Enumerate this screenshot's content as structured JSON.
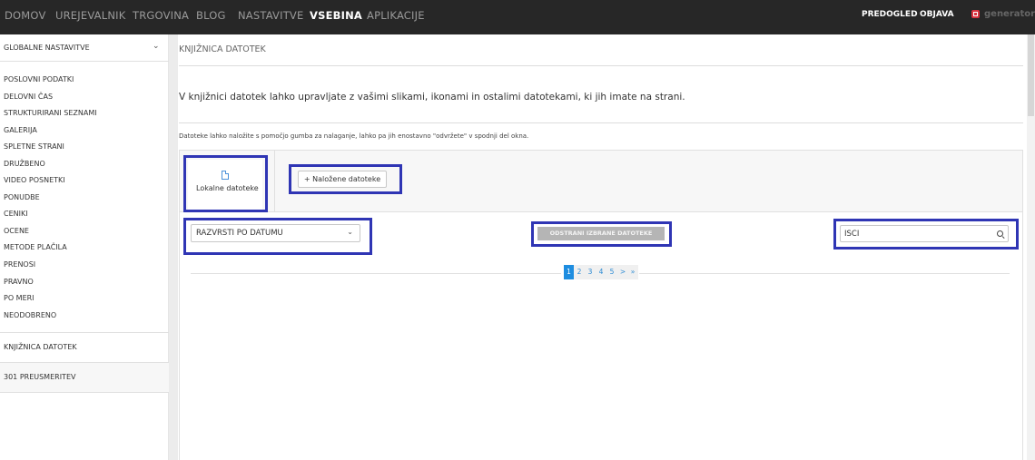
{
  "topnav": {
    "items": [
      {
        "label": "DOMOV"
      },
      {
        "label": "UREJEVALNIK"
      },
      {
        "label": "TRGOVINA"
      },
      {
        "label": "BLOG"
      },
      {
        "label": "NASTAVITVE"
      },
      {
        "label": "VSEBINA",
        "active": true
      },
      {
        "label": "APLIKACIJE"
      }
    ],
    "preview_label": "PREDOGLED",
    "publish_label": "OBJAVA",
    "brand_label": "generator"
  },
  "sidebar": {
    "header": "GLOBALNE NASTAVITVE",
    "items": [
      {
        "label": "POSLOVNI PODATKI"
      },
      {
        "label": "DELOVNI ČAS"
      },
      {
        "label": "STRUKTURIRANI SEZNAMI"
      },
      {
        "label": "GALERIJA"
      },
      {
        "label": "SPLETNE STRANI"
      },
      {
        "label": "DRUŽBENO"
      },
      {
        "label": "VIDEO POSNETKI"
      },
      {
        "label": "PONUDBE"
      },
      {
        "label": "CENIKI"
      },
      {
        "label": "OCENE"
      },
      {
        "label": "METODE PLAČILA"
      },
      {
        "label": "PRENOSI"
      },
      {
        "label": "PRAVNO"
      },
      {
        "label": "PO MERI"
      },
      {
        "label": "NEODOBRENO"
      }
    ],
    "file_library": "KNJIŽNICA DATOTEK",
    "redirects": "301 PREUSMERITEV"
  },
  "main": {
    "title": "KNJIŽNICA DATOTEK",
    "lead": "V knjižnici datotek lahko upravljate z vašimi slikami, ikonami in ostalimi datotekami, ki jih imate na strani.",
    "note": "Datoteke lahko naložite s pomočjo gumba za nalaganje, lahko pa jih enostavno \"odvržete\" v spodnji del okna.",
    "local_files_label": "Lokalne datoteke",
    "upload_button": "+ Naložene datoteke",
    "sort_label": "RAZVRSTI PO DATUMU",
    "delete_button": "ODSTRANI IZBRANE DATOTEKE",
    "search_placeholder": "IŠČI",
    "pagination": [
      "1",
      "2",
      "3",
      "4",
      "5",
      ">",
      "»"
    ],
    "current_page": "1"
  },
  "colors": {
    "topbar_bg": "#272727",
    "highlight_border": "#2f35b4",
    "active_page": "#1e8de0",
    "link": "#2a8ad4"
  },
  "icons": [
    "document-icon",
    "chevron-down-icon",
    "search-icon",
    "generator-logo-icon"
  ]
}
